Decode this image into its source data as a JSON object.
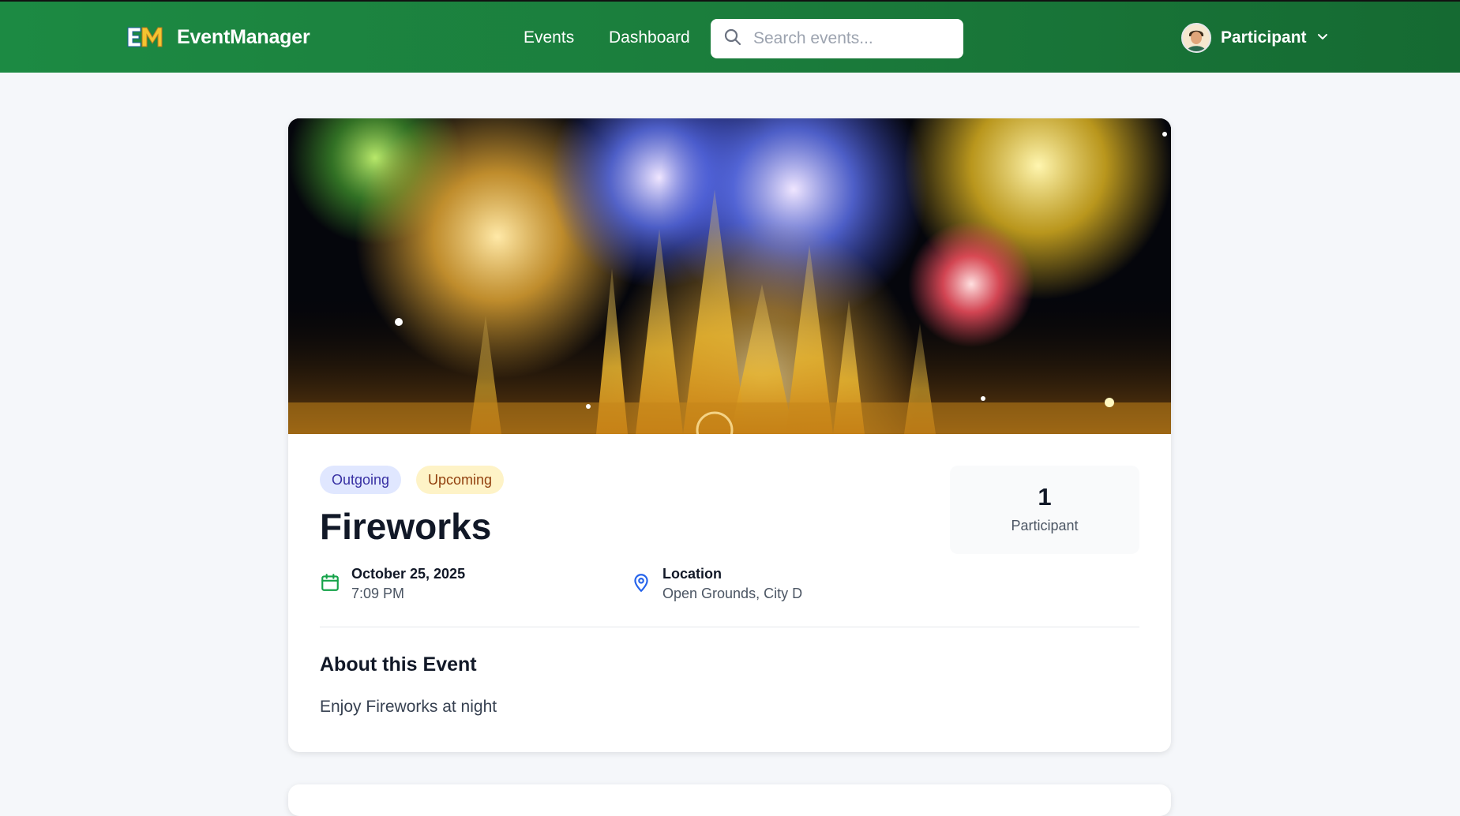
{
  "brand": {
    "logo_mark": "EM",
    "name": "EventManager"
  },
  "nav": {
    "events": "Events",
    "dashboard": "Dashboard"
  },
  "search": {
    "placeholder": "Search events...",
    "value": ""
  },
  "user": {
    "role": "Participant"
  },
  "event": {
    "badges": [
      "Outgoing",
      "Upcoming"
    ],
    "title": "Fireworks",
    "date": "October 25, 2025",
    "time": "7:09 PM",
    "location_label": "Location",
    "location": "Open Grounds, City D",
    "participants_count": "1",
    "participants_label": "Participant",
    "about_heading": "About this Event",
    "description": "Enjoy Fireworks at night"
  },
  "colors": {
    "header_green": "#1b7d3c",
    "badge_outgoing_bg": "#e0e7ff",
    "badge_upcoming_bg": "#fef3c7",
    "calendar_icon": "#16a34a",
    "location_icon": "#2563eb"
  },
  "icons": {
    "search": "search-icon",
    "chevron": "chevron-down-icon",
    "calendar": "calendar-icon",
    "location": "map-pin-icon",
    "avatar": "avatar"
  }
}
